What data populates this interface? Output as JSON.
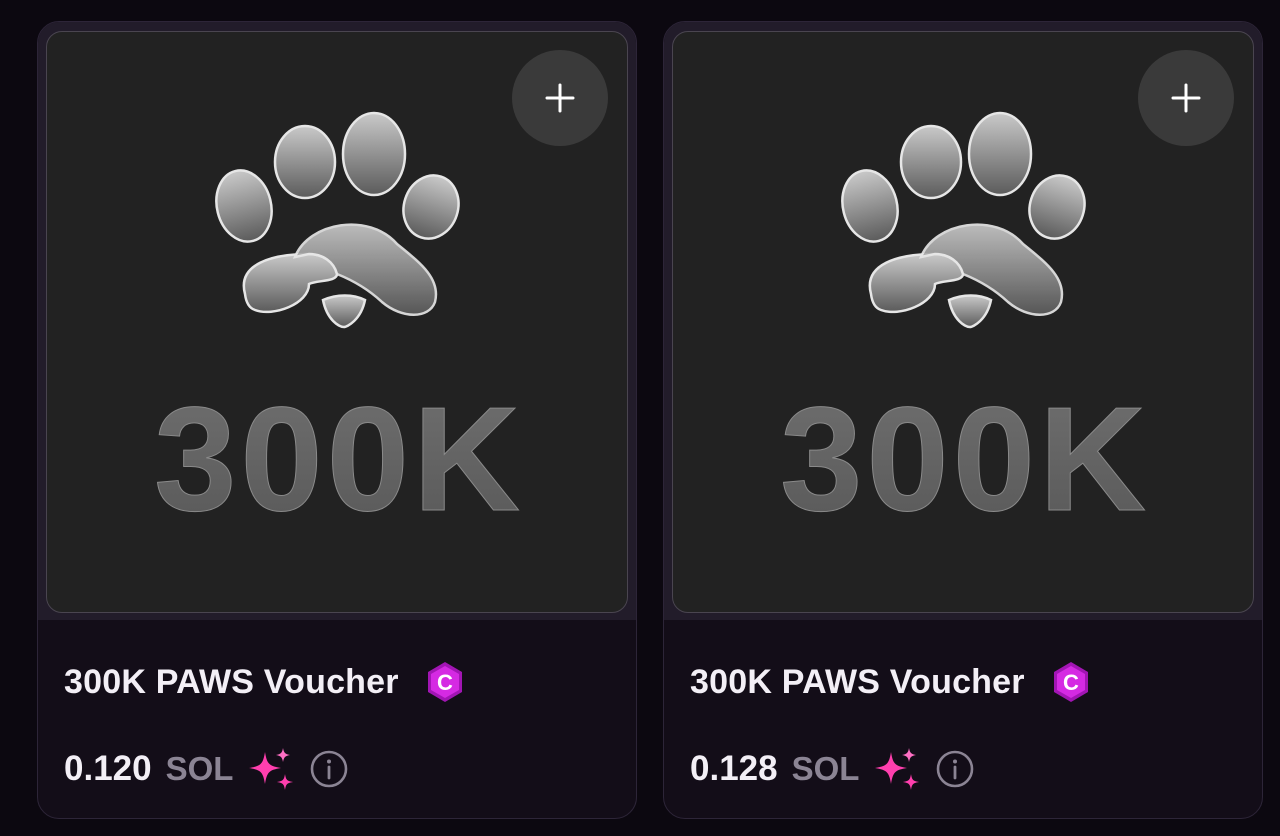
{
  "cards": [
    {
      "image_text": "300K",
      "image_icon": "paw-icon",
      "add_icon": "plus-icon",
      "title": "300K PAWS Voucher",
      "badge_icon": "c-badge-icon",
      "badge_letter": "C",
      "price": "0.120",
      "currency": "SOL",
      "currency_icon": "sparkle-icon",
      "info_icon": "info-icon"
    },
    {
      "image_text": "300K",
      "image_icon": "paw-icon",
      "add_icon": "plus-icon",
      "title": "300K PAWS Voucher",
      "badge_icon": "c-badge-icon",
      "badge_letter": "C",
      "price": "0.128",
      "currency": "SOL",
      "currency_icon": "sparkle-icon",
      "info_icon": "info-icon"
    }
  ],
  "colors": {
    "background": "#0c0810",
    "card": "#130d18",
    "badge": "#c21fd0",
    "sparkle": "#ff3fae",
    "muted_text": "#8b8494"
  }
}
